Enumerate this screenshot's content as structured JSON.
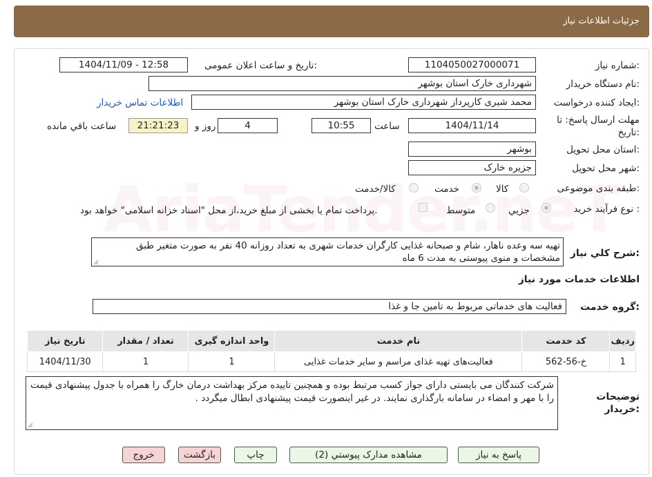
{
  "header": {
    "title": "جزئیات اطلاعات نیاز"
  },
  "fields": {
    "need_number_label": "شماره نیاز:",
    "need_number": "1104050027000071",
    "announce_label": "تاریخ و ساعت اعلان عمومی:",
    "announce_value": "1404/11/09 - 12:58",
    "buyer_label": "نام دستگاه خریدار:",
    "buyer_value": "شهرداری خارک استان بوشهر",
    "creator_label": "ایجاد کننده درخواست:",
    "creator_value": "محمد شیری کارپرداز شهرداری خارک استان بوشهر",
    "contact_link": "اطلاعات تماس خریدار",
    "deadline_label_line1": "مهلت ارسال پاسخ: تا",
    "deadline_label_line2": "تاریخ:",
    "deadline_date": "1404/11/14",
    "time_label": "ساعت",
    "deadline_time": "10:55",
    "days_value": "4",
    "days_label": "روز و",
    "remaining_time": "21:21:23",
    "remaining_label": "ساعت باقي مانده",
    "province_label": "استان محل تحویل:",
    "province_value": "بوشهر",
    "city_label": "شهر محل تحویل:",
    "city_value": "جزیره خارک",
    "category_label": "طبقه بندی موضوعی:",
    "category_options": [
      "کالا",
      "خدمت",
      "کالا/خدمت"
    ],
    "category_selected": "خدمت",
    "process_label": "نوع فرآیند خرید :",
    "process_options": [
      "جزیي",
      "متوسط"
    ],
    "process_selected": "جزیي",
    "treasury_note": "پرداخت تمام یا بخشی از مبلغ خرید،از محل \"اسناد خزانه اسلامی\" خواهد بود."
  },
  "description": {
    "label": "شرح کلي نیاز:",
    "text": "تهیه سه وعده ناهار، شام و صبحانه غذایی کارگران خدمات شهری به تعداد روزانه 40 نفر به صورت متغیر طبق مشخصات و منوی پیوستی به مدت 6 ماه"
  },
  "services_section": {
    "title": "اطلاعات خدمات مورد نیاز",
    "group_label": "گروه خدمت:",
    "group_value": "فعالیت های خدماتی مربوط به تامین جا و غذا"
  },
  "table": {
    "headers": [
      "ردیف",
      "کد خدمت",
      "نام خدمت",
      "واحد اندازه گیری",
      "تعداد / مقدار",
      "تاریخ نیاز"
    ],
    "rows": [
      [
        "1",
        "خ-56-562",
        "فعالیت‌های تهیه غذای مراسم و سایر خدمات غذایی",
        "1",
        "1",
        "1404/11/30"
      ]
    ]
  },
  "buyer_notes": {
    "label_line1": "توضیحات",
    "label_line2": "خریدار:",
    "text": "شرکت کنندگان می بایستی دارای جواز کسب مرتبط بوده و همچنین تاییده مرکز بهداشت درمان خارگ را همراه با جدول پیشنهادی قیمت را با مهر و امضاء در سامانه بارگذاری نمایند. در غیر اینصورت قیمت پیشنهادی ابطال میگردد ."
  },
  "buttons": {
    "reply": "پاسخ به نیاز",
    "attachments": "مشاهده مدارک پیوستي (2)",
    "print": "چاپ",
    "back": "بازگشت",
    "exit": "خروج"
  },
  "watermark": "AriaTender.neT",
  "colors": {
    "header_bg": "#8b6a47",
    "link": "#1a56c9",
    "remaining_bg": "#f7f3c6",
    "button_green": "#e9f7e4",
    "button_red": "#f7d4d4"
  }
}
